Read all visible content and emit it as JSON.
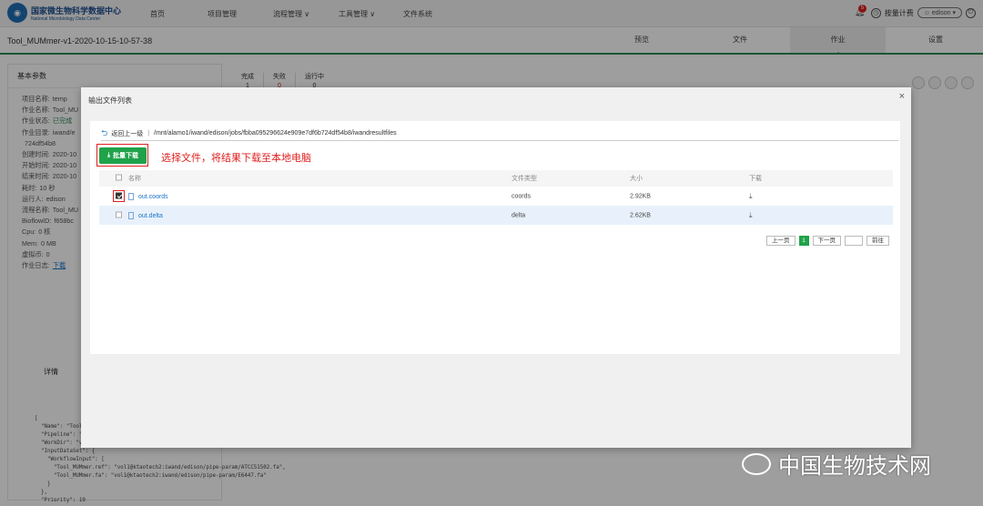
{
  "header": {
    "logo_cn": "国家微生物科学数据中心",
    "logo_en": "National Microbiology Data Center",
    "nav": [
      "首页",
      "项目管理",
      "流程管理 ∨",
      "工具管理 ∨",
      "文件系统"
    ],
    "notification_count": "5",
    "billing_label": "按量计费",
    "user": "edison"
  },
  "project": {
    "title": "Tool_MUMmer-v1-2020-10-15-10-57-38",
    "tabs": [
      "预览",
      "文件",
      "作业",
      "设置"
    ],
    "active_tab": "作业"
  },
  "left_panel": {
    "title": "基本参数",
    "rows": [
      {
        "label": "项目名称:",
        "value": "temp"
      },
      {
        "label": "作业名称:",
        "value": "Tool_MU"
      },
      {
        "label": "作业状态:",
        "value": "已完成"
      },
      {
        "label": "作业目录:",
        "value": "iwand/e"
      },
      {
        "label": "",
        "value": "724df54b8"
      },
      {
        "label": "创建时间:",
        "value": "2020-10"
      },
      {
        "label": "开始时间:",
        "value": "2020-10"
      },
      {
        "label": "结束时间:",
        "value": "2020-10"
      },
      {
        "label": "耗时:",
        "value": "10 秒"
      },
      {
        "label": "运行人:",
        "value": "edison"
      },
      {
        "label": "流程名称:",
        "value": "Tool_MU"
      },
      {
        "label": "BioflowID:",
        "value": "f658bc"
      },
      {
        "label": "Cpu:",
        "value": "0 核"
      },
      {
        "label": "Mem:",
        "value": "0 MB"
      },
      {
        "label": "虚拟币:",
        "value": "0"
      },
      {
        "label": "作业日志:",
        "value": "下载"
      }
    ],
    "stats": [
      {
        "label": "完成",
        "value": "1"
      },
      {
        "label": "失败",
        "value": "0"
      },
      {
        "label": "运行中",
        "value": "0"
      }
    ],
    "detail_tab": "详情",
    "json_lines": [
      "[",
      "  \"Name\": \"Tool_",
      "  \"Pipeline\": \"",
      "  \"WorkDir\": \"v",
      "  \"InputDataSet\": {",
      "    \"WorkflowInput\": [",
      "      \"Tool_MUMmer.ref\": \"vol1@ktaotech2:iwand/edison/pipe-param/ATCC51502.fa\",",
      "      \"Tool_MUMmer.fa\": \"vol1@ktaotech2:iwand/edison/pipe-param/E6447.fa\"",
      "    }",
      "  },",
      "  \"Priority\": 10"
    ]
  },
  "modal": {
    "title": "输出文件列表",
    "back_label": "返回上一级",
    "path": "/mnt/alamo1/iwand/edison/jobs/fbba095296624e909e7df6b724df54b8/iwandresultfiles",
    "batch_download": "批量下载",
    "annotation": "选择文件，将结果下载至本地电脑",
    "columns": [
      "名称",
      "文件类型",
      "大小",
      "下载"
    ],
    "files": [
      {
        "name": "out.coords",
        "type": "coords",
        "size": "2.92KB",
        "checked": true
      },
      {
        "name": "out.delta",
        "type": "delta",
        "size": "2.62KB",
        "checked": false
      }
    ],
    "pager": {
      "prev": "上一页",
      "current": "1",
      "next": "下一页",
      "goto": "前往"
    }
  },
  "watermark": "中国生物技术网"
}
